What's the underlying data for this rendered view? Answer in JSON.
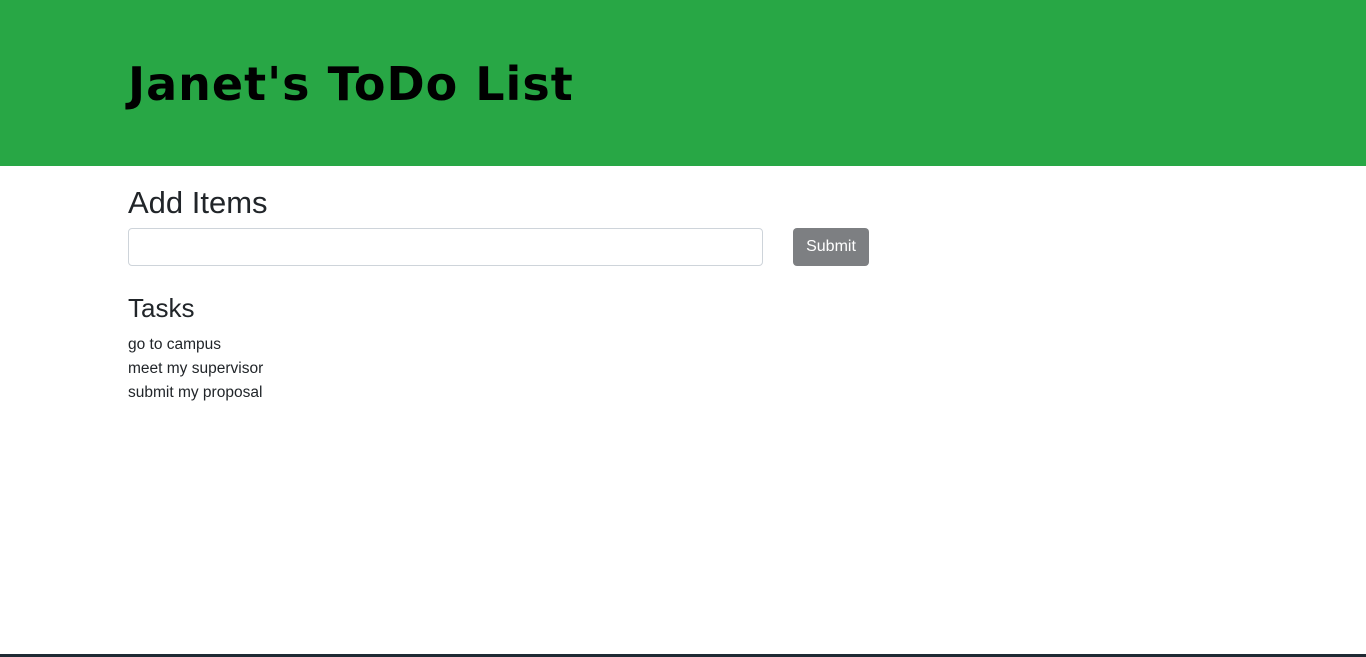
{
  "header": {
    "title": "Janet's ToDo List"
  },
  "add_section": {
    "heading": "Add Items",
    "input_value": "",
    "input_placeholder": "",
    "submit_label": "Submit"
  },
  "tasks_section": {
    "heading": "Tasks",
    "items": [
      "go to campus",
      "meet my supervisor",
      "submit my proposal"
    ]
  },
  "colors": {
    "header_background": "#28a745",
    "submit_button": "#7d7f82"
  }
}
